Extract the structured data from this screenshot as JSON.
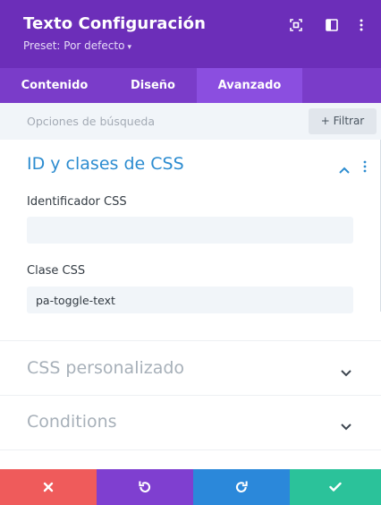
{
  "header": {
    "title": "Texto Configuración",
    "preset": "Preset: Por defecto",
    "bg_color": "#6c2eb9",
    "icons": [
      "fullscreen-icon",
      "split-view-icon",
      "more-options-icon"
    ]
  },
  "tabs": [
    {
      "label": "Contenido",
      "active": false
    },
    {
      "label": "Diseño",
      "active": false
    },
    {
      "label": "Avanzado",
      "active": true
    }
  ],
  "search": {
    "placeholder": "Opciones de búsqueda",
    "filter_label": "+ Filtrar"
  },
  "css_section": {
    "title": "ID y clases de CSS",
    "expanded": true,
    "id_label": "Identificador CSS",
    "id_value": "",
    "class_label": "Clase CSS",
    "class_value": "pa-toggle-text"
  },
  "collapsed_sections": [
    {
      "title": "CSS personalizado",
      "expanded": false
    },
    {
      "title": "Conditions",
      "expanded": false
    }
  ],
  "footer": {
    "buttons": [
      {
        "name": "close",
        "color": "#ef5b5b",
        "icon": "close-icon"
      },
      {
        "name": "undo",
        "color": "#7f3fd0",
        "icon": "undo-icon"
      },
      {
        "name": "redo",
        "color": "#2b88da",
        "icon": "redo-icon"
      },
      {
        "name": "save",
        "color": "#2bc29a",
        "icon": "check-icon"
      }
    ]
  }
}
